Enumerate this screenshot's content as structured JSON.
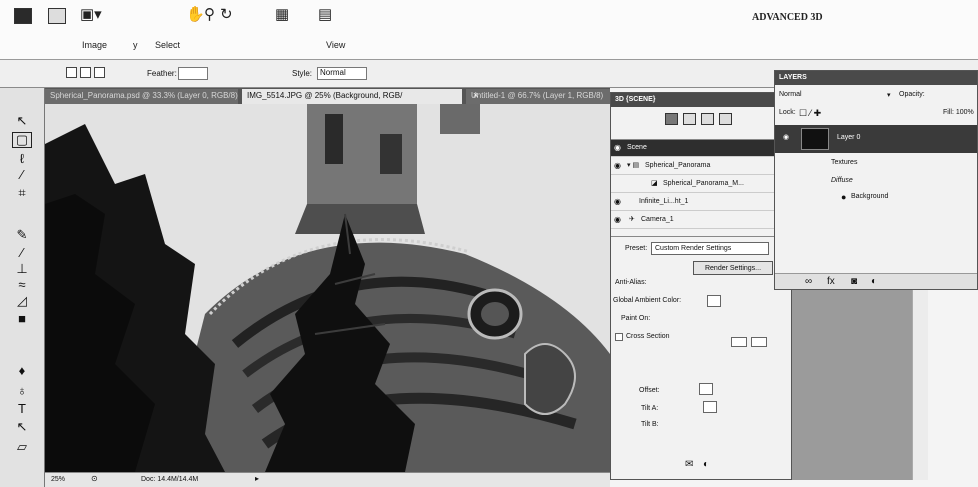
{
  "appbar": {
    "menu": [
      "Image",
      "y",
      "Select",
      "View"
    ],
    "workspace": "ADVANCED 3D"
  },
  "options": {
    "feather_label": "Feather:",
    "style_label": "Style:",
    "style_value": "Normal"
  },
  "tabs": [
    {
      "label": "Spherical_Panorama.psd @ 33.3% (Layer 0, RGB/8)",
      "active": false
    },
    {
      "label": "IMG_5514.JPG @ 25% (Background, RGB/",
      "active": true
    },
    {
      "label": "Untitled-1 @ 66.7% (Layer 1, RGB/8)",
      "active": false
    }
  ],
  "tools": [
    "move-tool-icon",
    "marquee-tool-icon",
    "lasso-tool-icon",
    "magic-wand-tool-icon",
    "crop-tool-icon",
    "eyedropper-tool-icon",
    "brush-tool-icon",
    "stamp-tool-icon",
    "history-brush-tool-icon",
    "eraser-tool-icon",
    "gradient-tool-icon",
    "dodge-tool-icon",
    "pen-tool-icon",
    "type-tool-icon",
    "path-select-tool-icon",
    "shape-tool-icon"
  ],
  "status": {
    "zoom": "25%",
    "doc": "Doc: 14.4M/14.4M"
  },
  "panel3d": {
    "title": "3D {SCENE}",
    "scene": [
      {
        "label": "Scene",
        "selected": true
      },
      {
        "label": "Spherical_Panorama",
        "selected": false
      },
      {
        "label": "Spherical_Panorama_M...",
        "selected": false
      },
      {
        "label": "Infinite_Li...ht_1",
        "selected": false
      },
      {
        "label": "Camera_1",
        "selected": false
      }
    ],
    "preset_label": "Preset:",
    "preset_value": "Custom Render Settings",
    "render_button": "Render Settings...",
    "anti_alias": "Anti-Alias:",
    "ambient": "Global Ambient Color:",
    "paint_on": "Paint On:",
    "cross_section": "Cross Section",
    "offset": "Offset:",
    "tilt_a": "Tilt A:",
    "tilt_b": "Tilt B:"
  },
  "layers": {
    "title": "LAYERS",
    "blend": "Normal",
    "opacity": "Opacity:",
    "lock": "Lock:",
    "fill": "Fill: 100%",
    "items": [
      {
        "label": "Layer 0",
        "selected": true
      },
      {
        "label": "Textures",
        "selected": false
      },
      {
        "label": "Diffuse",
        "selected": false
      },
      {
        "label": "Background",
        "selected": false
      }
    ]
  }
}
